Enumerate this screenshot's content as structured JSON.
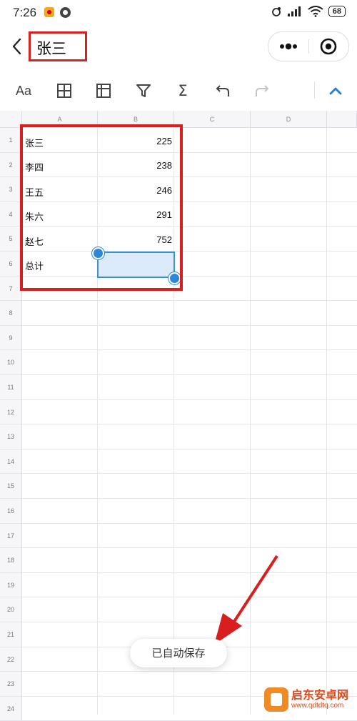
{
  "status_bar": {
    "time": "7:26",
    "battery": "68"
  },
  "titlebar": {
    "title": "张三"
  },
  "toolbar": {
    "buttons": [
      {
        "label": "Aa",
        "icon": "text-format-icon"
      },
      {
        "icon": "borders-icon"
      },
      {
        "icon": "freeze-panes-icon"
      },
      {
        "icon": "filter-icon"
      },
      {
        "label": "Σ",
        "icon": "sum-icon"
      },
      {
        "icon": "undo-icon"
      },
      {
        "icon": "redo-icon"
      },
      {
        "icon": "chevron-up-icon"
      }
    ]
  },
  "sheet": {
    "columns": [
      "A",
      "B",
      "C",
      "D"
    ],
    "rows": [
      "1",
      "2",
      "3",
      "4",
      "5",
      "6",
      "7",
      "8",
      "9",
      "10",
      "11",
      "12",
      "13",
      "14",
      "15",
      "16",
      "17",
      "18",
      "19",
      "20",
      "21",
      "22",
      "23",
      "24"
    ],
    "cells": [
      {
        "a": "张三",
        "b": "225"
      },
      {
        "a": "李四",
        "b": "238"
      },
      {
        "a": "王五",
        "b": "246"
      },
      {
        "a": "朱六",
        "b": "291"
      },
      {
        "a": "赵七",
        "b": "752"
      },
      {
        "a": "总计",
        "b": ""
      }
    ],
    "selected_cell": "B6"
  },
  "toast": {
    "text": "已自动保存"
  },
  "watermark": {
    "name": "启东安卓网",
    "url": "www.qdtdtq.com"
  },
  "colors": {
    "annotation_red": "#d81e1e",
    "selection_blue": "#2b88db",
    "accent_blue": "#1e7fd6"
  }
}
